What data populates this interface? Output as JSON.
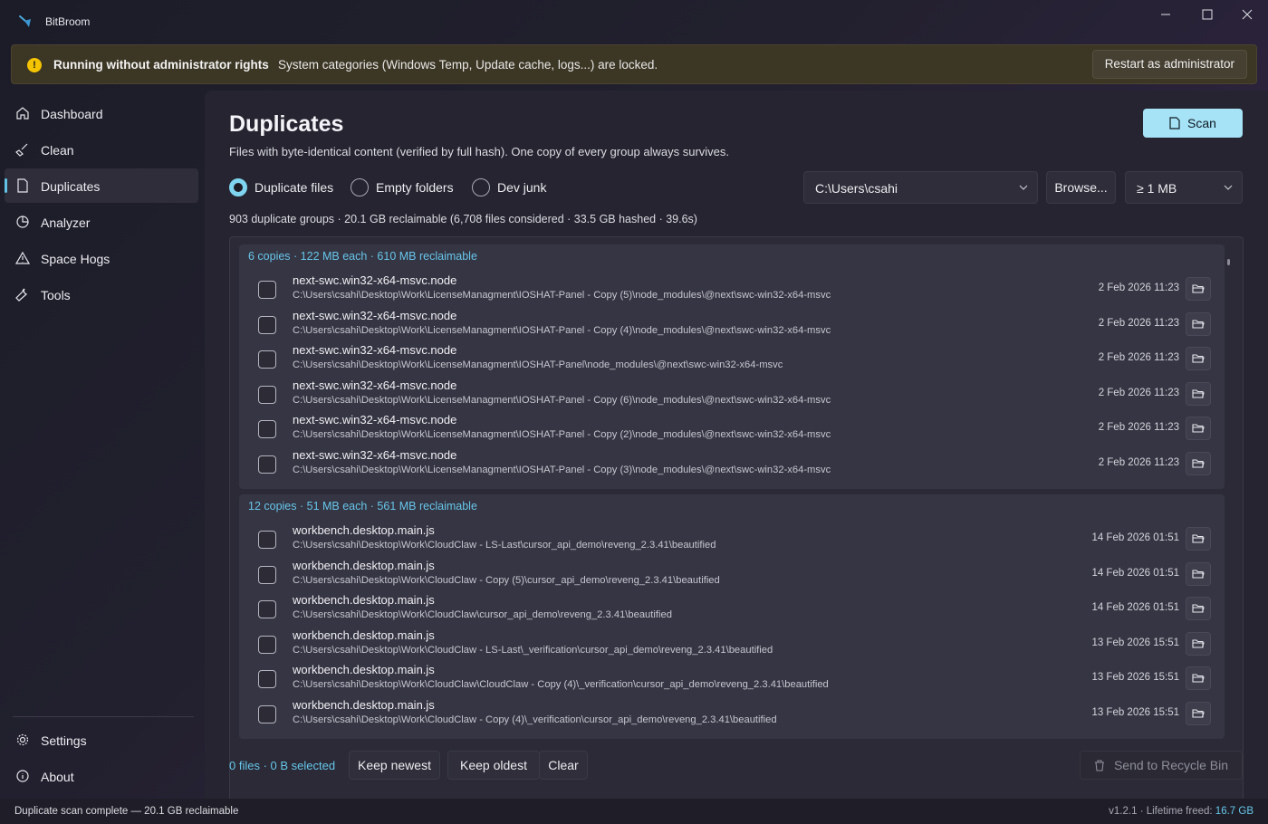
{
  "app": {
    "title": "BitBroom"
  },
  "banner": {
    "title": "Running without administrator rights",
    "message": "System categories (Windows Temp, Update cache, logs...) are locked.",
    "button": "Restart as administrator"
  },
  "sidebar": {
    "items": [
      {
        "label": "Dashboard",
        "icon": "home-icon"
      },
      {
        "label": "Clean",
        "icon": "broom-icon"
      },
      {
        "label": "Duplicates",
        "icon": "document-icon",
        "active": true
      },
      {
        "label": "Analyzer",
        "icon": "pie-chart-icon"
      },
      {
        "label": "Space Hogs",
        "icon": "warning-icon"
      },
      {
        "label": "Tools",
        "icon": "wrench-icon"
      }
    ],
    "footer": [
      {
        "label": "Settings",
        "icon": "gear-icon"
      },
      {
        "label": "About",
        "icon": "info-icon"
      }
    ]
  },
  "main": {
    "title": "Duplicates",
    "subtitle": "Files with byte-identical content (verified by full hash). One copy of every group always survives.",
    "scan_label": "Scan",
    "modes": [
      {
        "label": "Duplicate files",
        "selected": true
      },
      {
        "label": "Empty folders",
        "selected": false
      },
      {
        "label": "Dev junk",
        "selected": false
      }
    ],
    "path": "C:\\Users\\csahi",
    "browse_label": "Browse...",
    "min_size": "≥ 1 MB",
    "summary": "903 duplicate groups · 20.1 GB reclaimable (6,708 files considered · 33.5 GB hashed · 39.6s)"
  },
  "groups": [
    {
      "header": "6 copies · 122 MB each · 610 MB reclaimable",
      "files": [
        {
          "name": "next-swc.win32-x64-msvc.node",
          "path": "C:\\Users\\csahi\\Desktop\\Work\\LicenseManagment\\IOSHAT-Panel - Copy (5)\\node_modules\\@next\\swc-win32-x64-msvc",
          "date": "2 Feb 2026 11:23"
        },
        {
          "name": "next-swc.win32-x64-msvc.node",
          "path": "C:\\Users\\csahi\\Desktop\\Work\\LicenseManagment\\IOSHAT-Panel - Copy (4)\\node_modules\\@next\\swc-win32-x64-msvc",
          "date": "2 Feb 2026 11:23"
        },
        {
          "name": "next-swc.win32-x64-msvc.node",
          "path": "C:\\Users\\csahi\\Desktop\\Work\\LicenseManagment\\IOSHAT-Panel\\node_modules\\@next\\swc-win32-x64-msvc",
          "date": "2 Feb 2026 11:23"
        },
        {
          "name": "next-swc.win32-x64-msvc.node",
          "path": "C:\\Users\\csahi\\Desktop\\Work\\LicenseManagment\\IOSHAT-Panel - Copy (6)\\node_modules\\@next\\swc-win32-x64-msvc",
          "date": "2 Feb 2026 11:23"
        },
        {
          "name": "next-swc.win32-x64-msvc.node",
          "path": "C:\\Users\\csahi\\Desktop\\Work\\LicenseManagment\\IOSHAT-Panel - Copy (2)\\node_modules\\@next\\swc-win32-x64-msvc",
          "date": "2 Feb 2026 11:23"
        },
        {
          "name": "next-swc.win32-x64-msvc.node",
          "path": "C:\\Users\\csahi\\Desktop\\Work\\LicenseManagment\\IOSHAT-Panel - Copy (3)\\node_modules\\@next\\swc-win32-x64-msvc",
          "date": "2 Feb 2026 11:23"
        }
      ]
    },
    {
      "header": "12 copies · 51 MB each · 561 MB reclaimable",
      "files": [
        {
          "name": "workbench.desktop.main.js",
          "path": "C:\\Users\\csahi\\Desktop\\Work\\CloudClaw - LS-Last\\cursor_api_demo\\reveng_2.3.41\\beautified",
          "date": "14 Feb 2026 01:51"
        },
        {
          "name": "workbench.desktop.main.js",
          "path": "C:\\Users\\csahi\\Desktop\\Work\\CloudClaw - Copy (5)\\cursor_api_demo\\reveng_2.3.41\\beautified",
          "date": "14 Feb 2026 01:51"
        },
        {
          "name": "workbench.desktop.main.js",
          "path": "C:\\Users\\csahi\\Desktop\\Work\\CloudClaw\\cursor_api_demo\\reveng_2.3.41\\beautified",
          "date": "14 Feb 2026 01:51"
        },
        {
          "name": "workbench.desktop.main.js",
          "path": "C:\\Users\\csahi\\Desktop\\Work\\CloudClaw - LS-Last\\_verification\\cursor_api_demo\\reveng_2.3.41\\beautified",
          "date": "13 Feb 2026 15:51"
        },
        {
          "name": "workbench.desktop.main.js",
          "path": "C:\\Users\\csahi\\Desktop\\Work\\CloudClaw\\CloudClaw - Copy (4)\\_verification\\cursor_api_demo\\reveng_2.3.41\\beautified",
          "date": "13 Feb 2026 15:51"
        },
        {
          "name": "workbench.desktop.main.js",
          "path": "C:\\Users\\csahi\\Desktop\\Work\\CloudClaw - Copy (4)\\_verification\\cursor_api_demo\\reveng_2.3.41\\beautified",
          "date": "13 Feb 2026 15:51"
        }
      ]
    }
  ],
  "footer_actions": {
    "selection": "0 files · 0 B selected",
    "keep_newest": "Keep newest",
    "keep_oldest": "Keep oldest",
    "clear": "Clear",
    "recycle": "Send to Recycle Bin"
  },
  "statusbar": {
    "message": "Duplicate scan complete — 20.1 GB reclaimable",
    "version": "v1.2.1",
    "lifetime_label": "Lifetime freed:",
    "lifetime_value": "16.7 GB"
  },
  "colors": {
    "accent": "#66c6ea",
    "scan_button": "#a6e3f6",
    "warning": "#f5c400"
  }
}
